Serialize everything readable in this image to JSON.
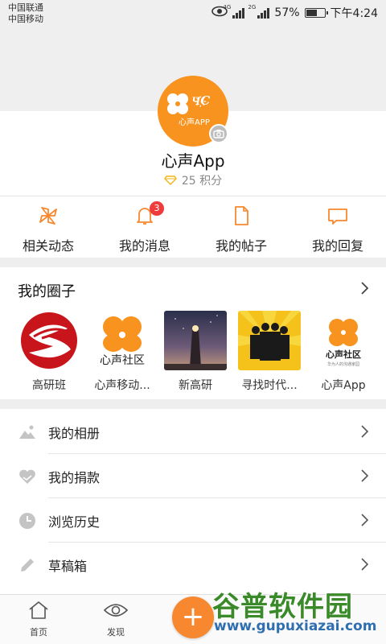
{
  "status_bar": {
    "carrier1": "中国联通",
    "carrier2": "中国移动",
    "net1": "4G",
    "net2": "2G",
    "battery": "57%",
    "battery_fraction": 0.57,
    "time": "下午4:24"
  },
  "profile": {
    "avatar_brand": "Ч҉C",
    "avatar_sub": "心声APP",
    "nickname": "心声App",
    "points": "25 积分"
  },
  "actions": [
    {
      "label": "相关动态",
      "icon": "pinwheel-icon"
    },
    {
      "label": "我的消息",
      "icon": "bell-icon",
      "badge": "3"
    },
    {
      "label": "我的帖子",
      "icon": "document-icon"
    },
    {
      "label": "我的回复",
      "icon": "chat-bubble-icon"
    }
  ],
  "circles": {
    "title": "我的圈子",
    "items": [
      {
        "name": "高研班"
      },
      {
        "name": "心声移动..."
      },
      {
        "name": "新高研"
      },
      {
        "name": "寻找时代..."
      },
      {
        "name": "心声App"
      }
    ],
    "logo_texts": {
      "xinsheng_community": "心声社区",
      "xinsheng_slogan": "华为人的沟通家园"
    }
  },
  "menu": [
    {
      "label": "我的相册",
      "icon": "photo-icon"
    },
    {
      "label": "我的捐款",
      "icon": "donate-heart-icon"
    },
    {
      "label": "浏览历史",
      "icon": "clock-icon"
    },
    {
      "label": "草稿箱",
      "icon": "pencil-icon"
    }
  ],
  "bottom_nav": {
    "home": "首页",
    "discover": "发现",
    "fab": "+"
  },
  "watermark": {
    "big": "谷普软件园",
    "small": "www.gupuxiazai.com"
  },
  "colors": {
    "accent": "#f7931e",
    "badge": "#ee3b3b"
  }
}
